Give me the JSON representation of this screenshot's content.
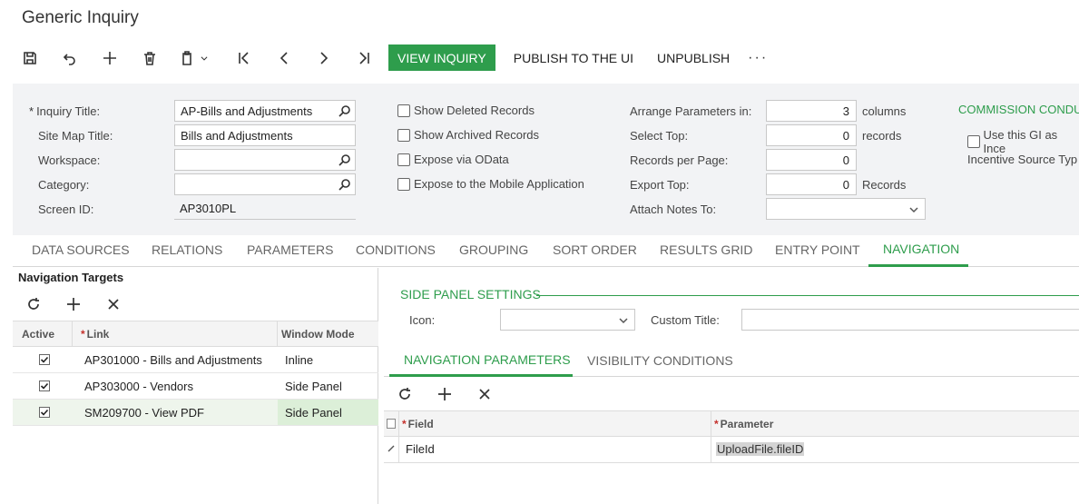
{
  "page": {
    "title": "Generic Inquiry"
  },
  "toolbar": {
    "icons": [
      "save-icon",
      "undo-icon",
      "add-icon",
      "delete-icon",
      "copy-paste-icon",
      "first-record-icon",
      "previous-icon",
      "next-icon",
      "last-record-icon"
    ],
    "view_inquiry": "VIEW INQUIRY",
    "publish": "PUBLISH TO THE UI",
    "unpublish": "UNPUBLISH",
    "more": "···"
  },
  "form": {
    "inquiry_title": {
      "label": "Inquiry Title:",
      "required_mark": "*",
      "value": "AP-Bills and Adjustments"
    },
    "site_map_title": {
      "label": "Site Map Title:",
      "value": "Bills and Adjustments"
    },
    "workspace": {
      "label": "Workspace:",
      "value": ""
    },
    "category": {
      "label": "Category:",
      "value": ""
    },
    "screen_id": {
      "label": "Screen ID:",
      "value": "AP3010PL"
    },
    "show_deleted": {
      "label": "Show Deleted Records",
      "checked": false
    },
    "show_archived": {
      "label": "Show Archived Records",
      "checked": false
    },
    "expose_odata": {
      "label": "Expose via OData",
      "checked": false
    },
    "expose_mobile": {
      "label": "Expose to the Mobile Application",
      "checked": false
    },
    "arrange_params": {
      "label": "Arrange Parameters in:",
      "value": "3",
      "unit": "columns"
    },
    "select_top": {
      "label": "Select Top:",
      "value": "0",
      "unit": "records"
    },
    "records_per_page": {
      "label": "Records per Page:",
      "value": "0"
    },
    "export_top": {
      "label": "Export Top:",
      "value": "0",
      "unit": "Records"
    },
    "attach_notes": {
      "label": "Attach Notes To:",
      "value": ""
    },
    "commission_header": "COMMISSION CONDU",
    "use_gi_incentive": {
      "label": "Use this GI as Ince",
      "checked": false
    },
    "incentive_source": {
      "label": "Incentive Source Typ"
    }
  },
  "tabs": [
    "DATA SOURCES",
    "RELATIONS",
    "PARAMETERS",
    "CONDITIONS",
    "GROUPING",
    "SORT ORDER",
    "RESULTS GRID",
    "ENTRY POINT",
    "NAVIGATION"
  ],
  "active_tab": "NAVIGATION",
  "nav_targets": {
    "title": "Navigation Targets",
    "columns": {
      "active": "Active",
      "link": "Link",
      "window_mode": "Window Mode",
      "required_mark": "*"
    },
    "rows": [
      {
        "active": true,
        "link": "AP301000 - Bills and Adjustments",
        "window_mode": "Inline"
      },
      {
        "active": true,
        "link": "AP303000 - Vendors",
        "window_mode": "Side Panel"
      },
      {
        "active": true,
        "link": "SM209700 - View PDF",
        "window_mode": "Side Panel"
      }
    ]
  },
  "side_panel": {
    "title": "SIDE PANEL SETTINGS",
    "icon_label": "Icon:",
    "icon_value": "",
    "custom_title_label": "Custom Title:",
    "custom_title_value": ""
  },
  "subtabs": [
    "NAVIGATION PARAMETERS",
    "VISIBILITY CONDITIONS"
  ],
  "active_subtab": "NAVIGATION PARAMETERS",
  "nav_params": {
    "columns": {
      "field": "Field",
      "parameter": "Parameter",
      "required_mark": "*"
    },
    "rows": [
      {
        "field": "FileId",
        "parameter": "UploadFile.fileID"
      }
    ]
  },
  "colors": {
    "accent": "#2e9d4c",
    "required": "#c4302b",
    "selected_row": "#eef5ec"
  }
}
